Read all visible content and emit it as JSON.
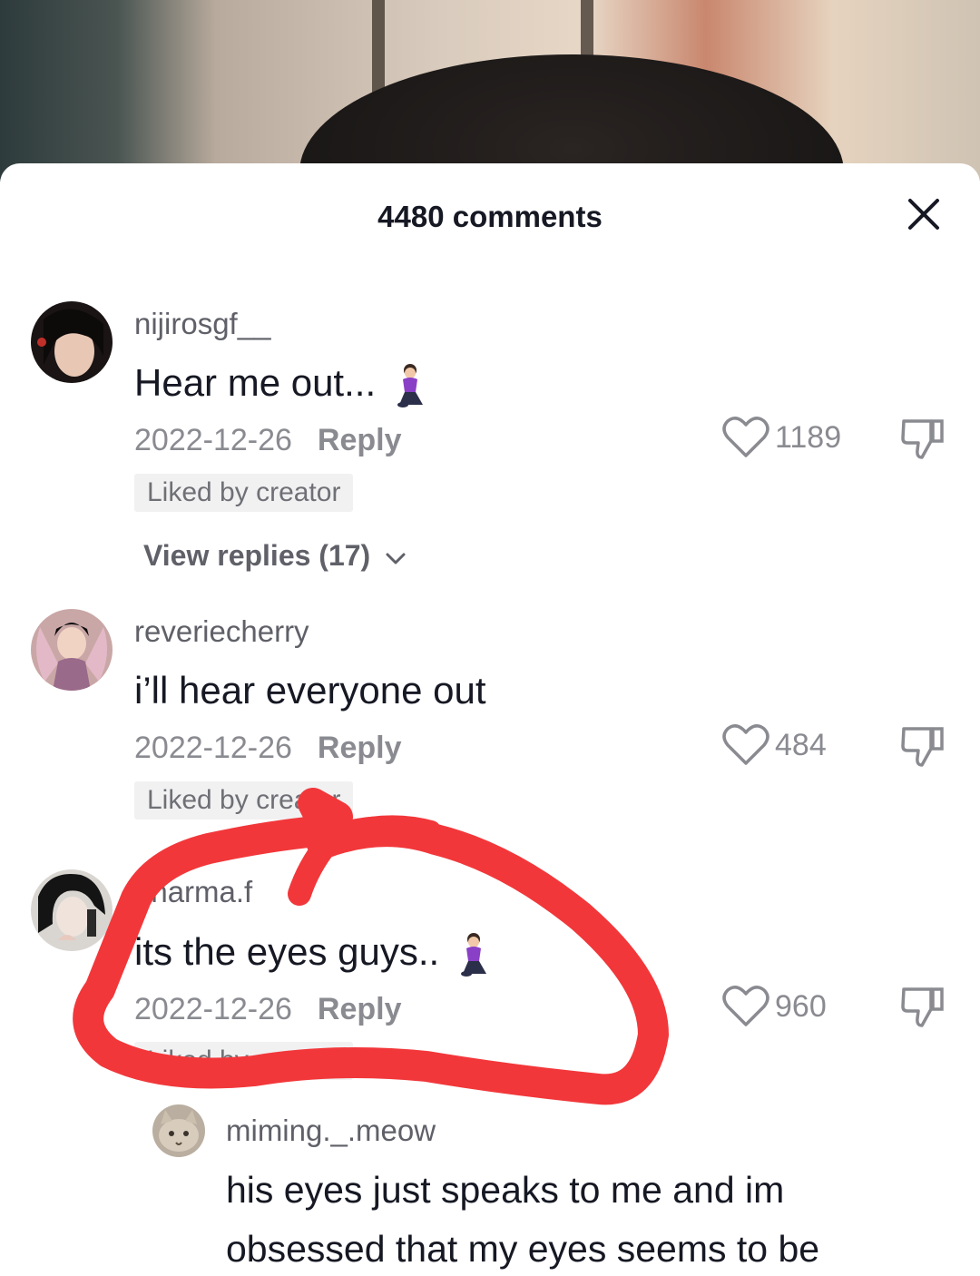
{
  "header": {
    "comment_count_label": "4480 comments",
    "close_icon": "close-icon"
  },
  "comments": [
    {
      "username": "nijirosgf__",
      "text": "Hear me out...",
      "emoji": "kneeling-person-icon",
      "date": "2022-12-26",
      "reply_label": "Reply",
      "like_count": "1189",
      "liked_by_creator_label": "Liked by creator",
      "view_replies_label": "View replies (17)"
    },
    {
      "username": "reveriecherry",
      "text": "i’ll hear everyone out",
      "date": "2022-12-26",
      "reply_label": "Reply",
      "like_count": "484",
      "liked_by_creator_label": "Liked by creator"
    },
    {
      "username": "dharma.f",
      "text": "its the eyes guys..",
      "emoji": "kneeling-person-icon",
      "date": "2022-12-26",
      "reply_label": "Reply",
      "like_count": "960",
      "liked_by_creator_label": "Liked by creator"
    }
  ],
  "reply": {
    "username": "miming._.meow",
    "text_line1": "his eyes just speaks to me and im",
    "text_line2": "obsessed that my eyes seems to be"
  },
  "colors": {
    "annotation_red": "#f2373a",
    "secondary_text": "#8a8b91",
    "badge_bg": "#f1f1f2"
  }
}
